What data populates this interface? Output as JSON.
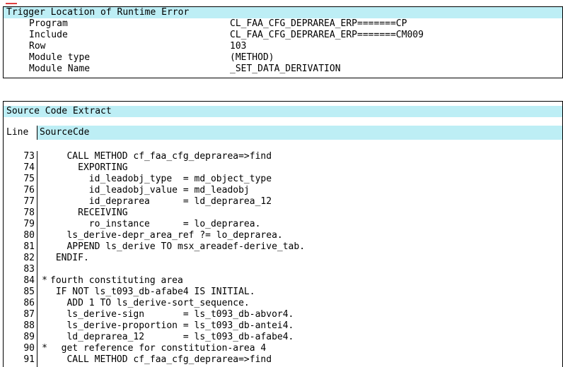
{
  "trigger": {
    "title": "Trigger Location of Runtime Error",
    "rows": [
      {
        "key": "Program",
        "value": "CL_FAA_CFG_DEPRAREA_ERP=======CP"
      },
      {
        "key": "Include",
        "value": "CL_FAA_CFG_DEPRAREA_ERP=======CM009"
      },
      {
        "key": "Row",
        "value": "103"
      },
      {
        "key": "Module type",
        "value": "(METHOD)"
      },
      {
        "key": "Module Name",
        "value": "_SET_DATA_DERIVATION"
      }
    ]
  },
  "source": {
    "title": "Source Code Extract",
    "col_line": "Line",
    "col_source": "SourceCde",
    "lines": [
      {
        "num": "73",
        "mark": "",
        "text": "   CALL METHOD cf_faa_cfg_deprarea=>find"
      },
      {
        "num": "74",
        "mark": "",
        "text": "     EXPORTING"
      },
      {
        "num": "75",
        "mark": "",
        "text": "       id_leadobj_type  = md_object_type"
      },
      {
        "num": "76",
        "mark": "",
        "text": "       id_leadobj_value = md_leadobj"
      },
      {
        "num": "77",
        "mark": "",
        "text": "       id_deprarea      = ld_deprarea_12"
      },
      {
        "num": "78",
        "mark": "",
        "text": "     RECEIVING"
      },
      {
        "num": "79",
        "mark": "",
        "text": "       ro_instance      = lo_deprarea."
      },
      {
        "num": "80",
        "mark": "",
        "text": "   ls_derive-depr_area_ref ?= lo_deprarea."
      },
      {
        "num": "81",
        "mark": "",
        "text": "   APPEND ls_derive TO msx_areadef-derive_tab."
      },
      {
        "num": "82",
        "mark": "",
        "text": " ENDIF."
      },
      {
        "num": "83",
        "mark": "",
        "text": ""
      },
      {
        "num": "84",
        "mark": "*",
        "text": "fourth constituting area"
      },
      {
        "num": "85",
        "mark": "",
        "text": " IF NOT ls_t093_db-afabe4 IS INITIAL."
      },
      {
        "num": "86",
        "mark": "",
        "text": "   ADD 1 TO ls_derive-sort_sequence."
      },
      {
        "num": "87",
        "mark": "",
        "text": "   ls_derive-sign       = ls_t093_db-abvor4."
      },
      {
        "num": "88",
        "mark": "",
        "text": "   ls_derive-proportion = ls_t093_db-antei4."
      },
      {
        "num": "89",
        "mark": "",
        "text": "   ld_deprarea_12       = ls_t093_db-afabe4."
      },
      {
        "num": "90",
        "mark": "*",
        "text": "  get reference for constitution-area 4"
      },
      {
        "num": "91",
        "mark": "",
        "text": "   CALL METHOD cf_faa_cfg_deprarea=>find"
      }
    ]
  }
}
